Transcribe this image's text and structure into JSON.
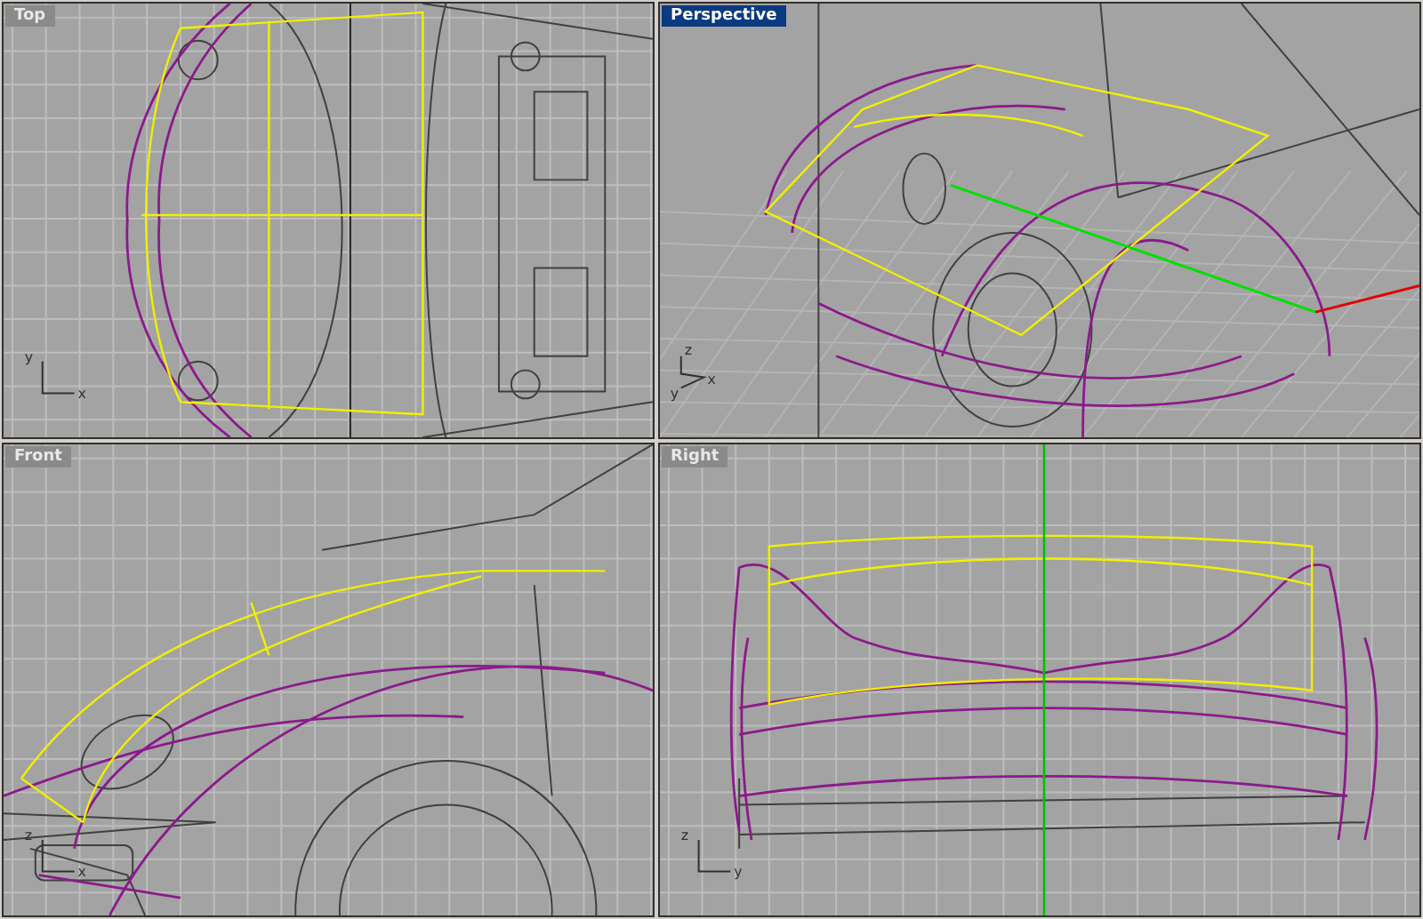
{
  "viewports": [
    {
      "title": "Top",
      "kind": "top",
      "selected": false,
      "axes": [
        "y",
        "x"
      ]
    },
    {
      "title": "Perspective",
      "kind": "perspective",
      "selected": true,
      "axes": [
        "z",
        "x",
        "y"
      ]
    },
    {
      "title": "Front",
      "kind": "front",
      "selected": false,
      "axes": [
        "z",
        "x"
      ]
    },
    {
      "title": "Right",
      "kind": "right",
      "selected": false,
      "axes": [
        "z",
        "y"
      ]
    }
  ]
}
